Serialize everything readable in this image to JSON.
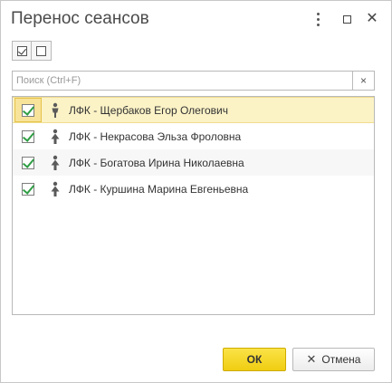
{
  "window": {
    "title": "Перенос сеансов"
  },
  "titlebar": {
    "more_icon": "more-vertical-icon",
    "maximize_icon": "maximize-icon",
    "close_icon": "close-icon",
    "close_glyph": "✕"
  },
  "toolbar": {
    "buttons": [
      {
        "icon": "check-all-icon",
        "checked": true
      },
      {
        "icon": "uncheck-all-icon",
        "checked": false
      }
    ]
  },
  "search": {
    "placeholder": "Поиск (Ctrl+F)",
    "value": "",
    "clear_glyph": "×"
  },
  "list": {
    "items": [
      {
        "label": "ЛФК - Щербаков Егор Олегович",
        "checked": true,
        "icon": "male-person-icon",
        "selected": true
      },
      {
        "label": "ЛФК - Некрасова Эльза Фроловна",
        "checked": true,
        "icon": "female-person-icon",
        "selected": false
      },
      {
        "label": "ЛФК - Богатова Ирина Николаевна",
        "checked": true,
        "icon": "female-person-icon",
        "selected": false
      },
      {
        "label": "ЛФК - Куршина Марина Евгеньевна",
        "checked": true,
        "icon": "female-person-icon",
        "selected": false
      }
    ]
  },
  "footer": {
    "ok_label": "ОК",
    "cancel_label": "Отмена",
    "cancel_glyph": "✕"
  },
  "colors": {
    "ok_button": "#f3d42b",
    "selected_row": "#fbf2c6",
    "checkmark": "#2f9e44"
  }
}
